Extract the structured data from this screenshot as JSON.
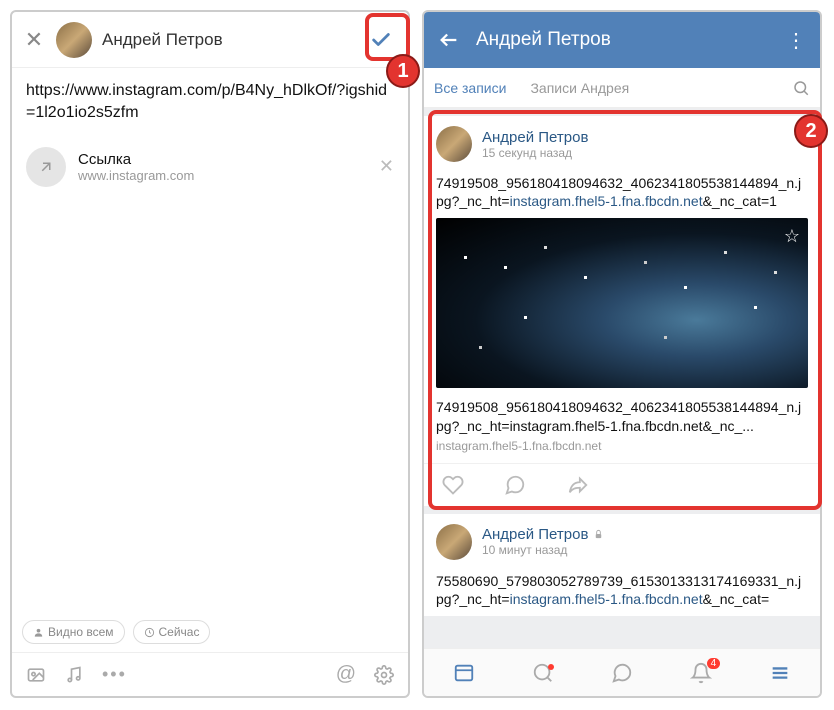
{
  "callouts": {
    "one": "1",
    "two": "2"
  },
  "compose": {
    "name": "Андрей Петров",
    "text": "https://www.instagram.com/p/B4Ny_hDlkOf/?igshid=1l2o1io2s5zfm",
    "link_title": "Ссылка",
    "link_host": "www.instagram.com",
    "visibility": "Видно всем",
    "schedule": "Сейчас"
  },
  "feed": {
    "title": "Андрей Петров",
    "tabs": {
      "all": "Все записи",
      "user": "Записи Андрея"
    },
    "post1": {
      "name": "Андрей Петров",
      "time": "15 секунд назад",
      "body_pre": "74919508_956180418094632_4062341805538144894_n.jpg?_nc_ht=",
      "body_link": "instagram.fhel5-1.fna.fbcdn.net",
      "body_post": "&_nc_cat=1",
      "preview_text": "74919508_956180418094632_4062341805538144894_n.jpg?_nc_ht=instagram.fhel5-1.fna.fbcdn.net&_nc_...",
      "preview_host": "instagram.fhel5-1.fna.fbcdn.net"
    },
    "post2": {
      "name": "Андрей Петров",
      "time": "10 минут назад",
      "body_pre": "75580690_579803052789739_6153013313174169331_n.jpg?_nc_ht=",
      "body_link": "instagram.fhel5-1.fna.fbcdn.net",
      "body_post": "&_nc_cat="
    },
    "nav_badge": "4"
  }
}
